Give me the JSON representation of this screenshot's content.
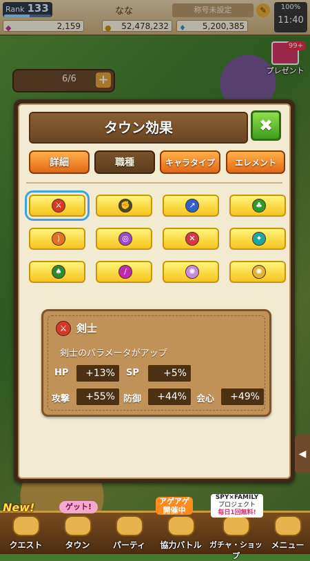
{
  "status": {
    "rank_label": "Rank",
    "rank_value": "133",
    "rank_progress": 0.55,
    "player_name": "なな",
    "title": "称号未設定",
    "battery": "100%",
    "time": "11:40",
    "gems": "2,159",
    "gold": "52,478,232",
    "third_currency": "5,200,385"
  },
  "town": {
    "party_count": "6/6",
    "present_badge": "99+",
    "present_label": "プレゼント"
  },
  "panel": {
    "title": "タウン効果",
    "close_symbol": "✖",
    "tabs": [
      {
        "label": "詳細",
        "active": false
      },
      {
        "label": "職種",
        "active": true
      },
      {
        "label": "キャラタイプ",
        "active": false
      },
      {
        "label": "エレメント",
        "active": false
      }
    ],
    "job_icons": [
      {
        "icon": "sword-icon",
        "color": "#d23a2a",
        "glyph": "⚔"
      },
      {
        "icon": "fist-icon",
        "color": "#4a4a2a",
        "glyph": "✊"
      },
      {
        "icon": "spear-icon",
        "color": "#2f5fd0",
        "glyph": "↗"
      },
      {
        "icon": "axe-icon",
        "color": "#2f9a2f",
        "glyph": "♣"
      },
      {
        "icon": "bow-icon",
        "color": "#e0722a",
        "glyph": ")"
      },
      {
        "icon": "staff-icon",
        "color": "#9a4ad0",
        "glyph": "◎"
      },
      {
        "icon": "dagger-icon",
        "color": "#d23a4a",
        "glyph": "✕"
      },
      {
        "icon": "gun-icon",
        "color": "#1fa6a0",
        "glyph": "✦"
      },
      {
        "icon": "shield-icon",
        "color": "#2f8a2f",
        "glyph": "♠"
      },
      {
        "icon": "wand-icon",
        "color": "#c02ab0",
        "glyph": "/"
      },
      {
        "icon": "magic-circle-icon",
        "color": "#c68ae0",
        "glyph": "✺"
      },
      {
        "icon": "gold-circle-icon",
        "color": "#e0b43a",
        "glyph": "✺"
      }
    ],
    "info": {
      "job_name": "剣士",
      "description": "剣士のパラメータがアップ",
      "hp_label": "HP",
      "hp_value": "+13%",
      "sp_label": "SP",
      "sp_value": "+5%",
      "atk_label": "攻撃",
      "atk_value": "+55%",
      "def_label": "防御",
      "def_value": "+44%",
      "crit_label": "会心",
      "crit_value": "+49%"
    }
  },
  "nav": {
    "new_tag": "New!",
    "get_tag": "ゲット!",
    "ageage_line1": "アゲアゲ",
    "ageage_line2": "開催中",
    "spy_title": "SPY×FAMILY",
    "spy_line1": "プロジェクト",
    "spy_line2": "毎日1回無料!",
    "items": [
      {
        "label": "クエスト"
      },
      {
        "label": "タウン"
      },
      {
        "label": "パーティ"
      },
      {
        "label": "協力バトル"
      },
      {
        "label": "ガチャ・ショップ"
      },
      {
        "label": "メニュー"
      }
    ]
  },
  "colors": {
    "tab_orange": "#e36815",
    "tab_active": "#5e3d1c",
    "button_yellow": "#f6c51e",
    "close_green": "#3e9e1e",
    "selection_blue": "#3ca2e8"
  }
}
